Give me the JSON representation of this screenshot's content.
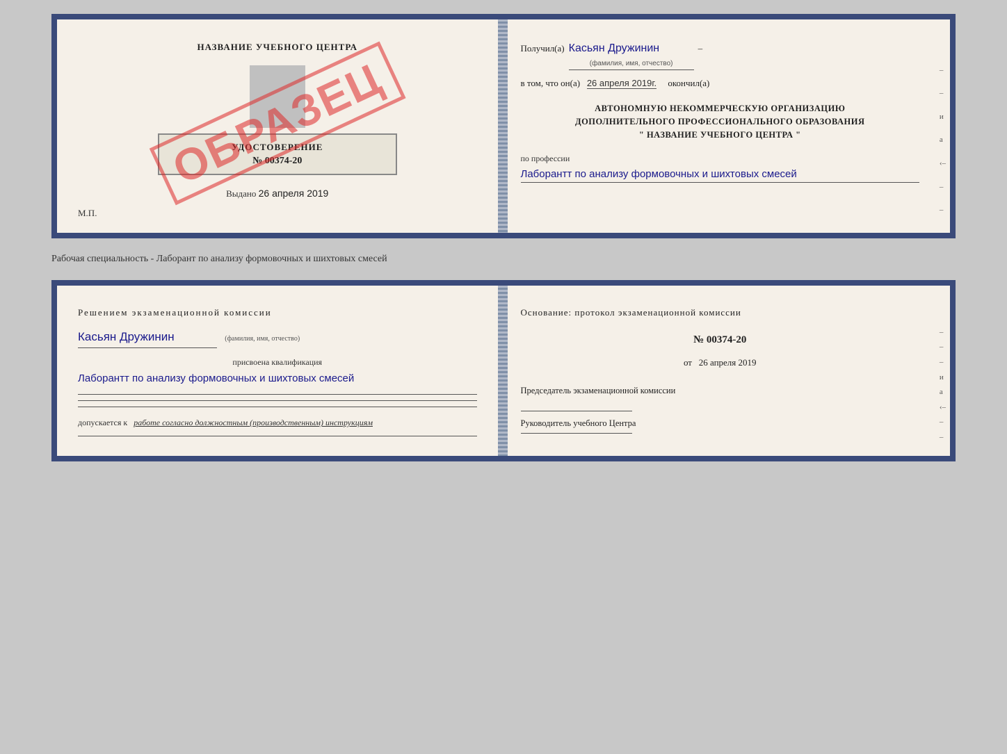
{
  "top_document": {
    "left": {
      "title": "НАЗВАНИЕ УЧЕБНОГО ЦЕНТРА",
      "udostoverenie_label": "УДОСТОВЕРЕНИЕ",
      "udostoverenie_number": "№ 00374-20",
      "vydano_prefix": "Выдано",
      "vydano_date": "26 апреля 2019",
      "mp_label": "М.П.",
      "obrazets": "ОБРАЗЕЦ"
    },
    "right": {
      "poluchil_prefix": "Получил(а)",
      "poluchil_name": "Касьян Дружинин",
      "fio_hint": "(фамилия, имя, отчество)",
      "vtom_prefix": "в том, что он(а)",
      "vtom_date": "26 апреля 2019г.",
      "okончил": "окончил(а)",
      "org_line1": "АВТОНОМНУЮ НЕКОММЕРЧЕСКУЮ ОРГАНИЗАЦИЮ",
      "org_line2": "ДОПОЛНИТЕЛЬНОГО ПРОФЕССИОНАЛЬНОГО ОБРАЗОВАНИЯ",
      "org_line3": "\" НАЗВАНИЕ УЧЕБНОГО ЦЕНТРА \"",
      "po_professii_label": "по профессии",
      "professiya": "Лаборантт по анализу формовочных и шихтовых смесей",
      "right_chars": [
        "–",
        "–",
        "и",
        "а",
        "‹–",
        "–",
        "–"
      ]
    }
  },
  "separator": {
    "text": "Рабочая специальность - Лаборант по анализу формовочных и шихтовых смесей"
  },
  "bottom_document": {
    "left": {
      "resheniem_label": "Решением  экзаменационной  комиссии",
      "name": "Касьян Дружинин",
      "fio_hint": "(фамилия, имя, отчество)",
      "prisvoena_label": "присвоена квалификация",
      "kvalifikatsiya": "Лаборантт по анализу формовочных и шихтовых смесей",
      "dopuskaetsya_prefix": "допускается к",
      "dopuskaetsya_text": "работе согласно должностным (производственным) инструкциям"
    },
    "right": {
      "osnovanie_label": "Основание: протокол экзаменационной  комиссии",
      "protocol_number": "№  00374-20",
      "ot_label": "от",
      "ot_date": "26 апреля 2019",
      "predsedatel_label": "Председатель экзаменационной комиссии",
      "rukovoditel_label": "Руководитель учебного Центра",
      "right_chars": [
        "–",
        "–",
        "–",
        "и",
        "а",
        "‹–",
        "–",
        "–"
      ]
    }
  }
}
